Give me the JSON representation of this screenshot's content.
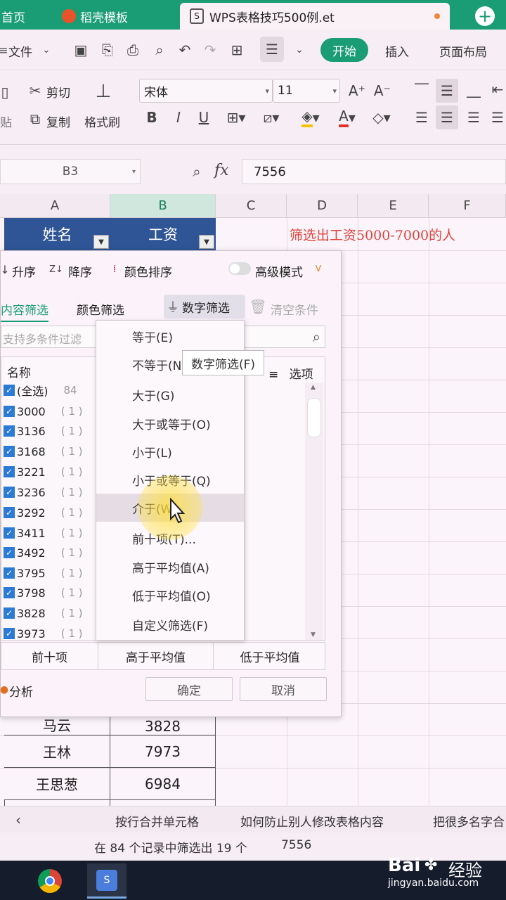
{
  "tabs": {
    "home": "首页",
    "template": "稻壳模板",
    "file": "WPS表格技巧500例.et"
  },
  "toolbar": {
    "file_menu": "文件",
    "start": "开始",
    "insert": "插入",
    "page_layout": "页面布局"
  },
  "ribbon": {
    "cut": "剪切",
    "paste": "贴",
    "copy": "复制",
    "format_painter": "格式刷",
    "font_name": "宋体",
    "font_size": "11"
  },
  "formula": {
    "cell_ref": "B3",
    "fx": "fx",
    "value": "7556"
  },
  "columns": [
    "A",
    "B",
    "C",
    "D",
    "E",
    "F"
  ],
  "table": {
    "header_name": "姓名",
    "header_salary": "工资",
    "note": "筛选出工资5000-7000的人",
    "rows": [
      {
        "name": "马云",
        "salary": "3828"
      },
      {
        "name": "王林",
        "salary": "7973"
      },
      {
        "name": "王思葱",
        "salary": "6984"
      }
    ]
  },
  "dialog": {
    "sort_asc": "升序",
    "sort_desc": "降序",
    "color_sort": "颜色排序",
    "advanced_mode": "高级模式",
    "tab_content": "内容筛选",
    "tab_color": "颜色筛选",
    "tab_number": "数字筛选",
    "clear_conditions": "清空条件",
    "search_placeholder": "支持多条件过滤",
    "list_header": "名称",
    "options": "选项",
    "tooltip": "数字筛选(F)",
    "items": [
      {
        "label": "(全选)",
        "count": "84"
      },
      {
        "label": "3000",
        "count": "( 1 )"
      },
      {
        "label": "3136",
        "count": "( 1 )"
      },
      {
        "label": "3168",
        "count": "( 1 )"
      },
      {
        "label": "3221",
        "count": "( 1 )"
      },
      {
        "label": "3236",
        "count": "( 1 )"
      },
      {
        "label": "3292",
        "count": "( 1 )"
      },
      {
        "label": "3411",
        "count": "( 1 )"
      },
      {
        "label": "3492",
        "count": "( 1 )"
      },
      {
        "label": "3795",
        "count": "( 1 )"
      },
      {
        "label": "3798",
        "count": "( 1 )"
      },
      {
        "label": "3828",
        "count": "( 1 )"
      },
      {
        "label": "3973",
        "count": "( 1 )"
      }
    ],
    "number_menu": [
      "等于(E)",
      "不等于(N",
      "大于(G)",
      "大于或等于(O)",
      "小于(L)",
      "小于或等于(Q)",
      "介于(W)",
      "前十项(T)...",
      "高于平均值(A)",
      "低于平均值(O)",
      "自定义筛选(F)"
    ],
    "top10": "前十项",
    "above_avg": "高于平均值",
    "below_avg": "低于平均值",
    "analyze": "分析",
    "ok": "确定",
    "cancel": "取消"
  },
  "sheet_tabs": [
    "按行合并单元格",
    "如何防止别人修改表格内容",
    "把很多名字合"
  ],
  "status": {
    "summary": "在 84 个记录中筛选出 19 个",
    "value": "7556"
  },
  "watermark": {
    "brand": "Bai",
    "brand2": "经验",
    "url": "jingyan.baidu.com"
  },
  "colors": {
    "tabbar": "#1a9d74",
    "header_cell": "#2f5597",
    "note": "#e0423a",
    "accent_green": "#1a9d74"
  }
}
